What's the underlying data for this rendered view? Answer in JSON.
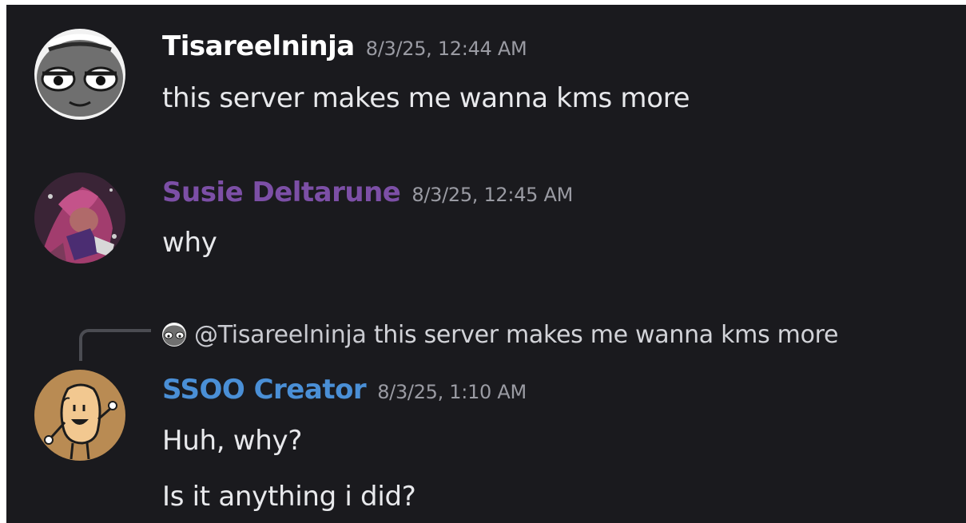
{
  "messages": [
    {
      "username": "Tisareelninja",
      "username_color": "#ffffff",
      "timestamp": "8/3/25, 12:44 AM",
      "lines": [
        "this server makes me wanna kms more"
      ],
      "avatar_icon": "gray-face-avatar-icon"
    },
    {
      "username": "Susie Deltarune",
      "username_color": "#7c4fa6",
      "timestamp": "8/3/25, 12:45 AM",
      "lines": [
        "why"
      ],
      "avatar_icon": "susie-deltarune-avatar-icon"
    },
    {
      "username": "SSOO Creator",
      "username_color": "#4a8fd6",
      "timestamp": "8/3/25, 1:10 AM",
      "lines": [
        "Huh, why?",
        "Is it anything i did?"
      ],
      "avatar_icon": "cartoon-character-avatar-icon",
      "reply": {
        "mention": "@Tisareelninja",
        "text": "this server makes me wanna kms more",
        "avatar_icon": "gray-face-avatar-icon"
      }
    }
  ],
  "colors": {
    "background": "#1a1a1e",
    "text": "#e8e9ec",
    "timestamp": "#9a9ba3"
  }
}
